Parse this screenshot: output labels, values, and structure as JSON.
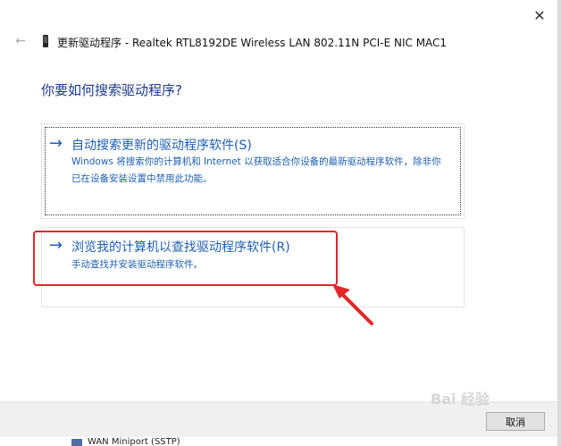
{
  "window": {
    "close_glyph": "✕",
    "back_glyph": "←",
    "title": "更新驱动程序 - Realtek RTL8192DE Wireless LAN 802.11N PCI-E NIC MAC1"
  },
  "prompt": "你要如何搜索驱动程序?",
  "options": [
    {
      "arrow": "→",
      "title": "自动搜索更新的驱动程序软件(S)",
      "description": "Windows 将搜索你的计算机和 Internet 以获取适合你设备的最新驱动程序软件，除非你已在设备安装设置中禁用此功能。"
    },
    {
      "arrow": "→",
      "title": "浏览我的计算机以查找驱动程序软件(R)",
      "description": "手动查找并安装驱动程序软件。"
    }
  ],
  "footer": {
    "cancel_label": "取消"
  },
  "watermark": "Bai 经验",
  "background_list": {
    "item": "WAN Miniport (SSTP)"
  },
  "colors": {
    "link": "#1e5fb0",
    "annotation": "#e3262b",
    "footer_bg": "#f0f0f0"
  },
  "icons": {
    "device": "network-adapter-icon",
    "annotation": "red-arrow"
  }
}
